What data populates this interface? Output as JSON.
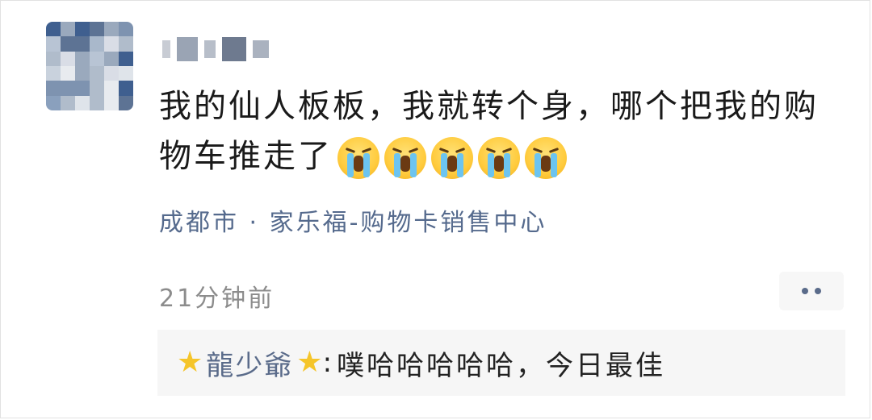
{
  "post": {
    "text": "我的仙人板板，我就转个身，哪个把我的购物车推走了",
    "emoji": "crying-face-emoji",
    "emoji_count": 5,
    "location": "成都市 · 家乐福-购物卡销售中心",
    "time": "21分钟前"
  },
  "comment": {
    "author": "龍少爺",
    "separator": ":",
    "text": "噗哈哈哈哈哈，今日最佳"
  },
  "colors": {
    "link": "#556a8d",
    "time": "#8c8c8c",
    "comment_bg": "#f6f6f6"
  }
}
